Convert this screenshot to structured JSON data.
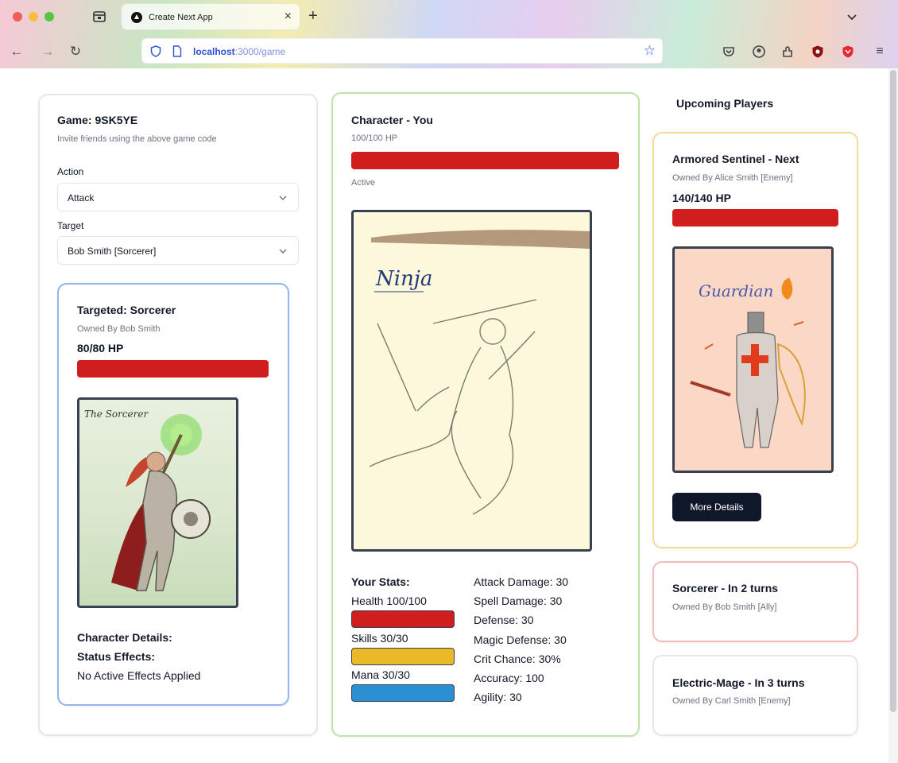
{
  "browser": {
    "tab_title": "Create Next App",
    "url_host": "localhost",
    "url_path": ":3000/game"
  },
  "game_panel": {
    "title": "Game: 9SK5YE",
    "subtitle": "Invite friends using the above game code",
    "action_label": "Action",
    "action_value": "Attack",
    "target_label": "Target",
    "target_value": "Bob Smith [Sorcerer]"
  },
  "targeted": {
    "title": "Targeted: Sorcerer",
    "owner": "Owned By Bob Smith",
    "hp_text": "80/80 HP",
    "hp_fraction": 1.0,
    "art_caption": "The Sorcerer",
    "details_label": "Character Details:",
    "status_label": "Status Effects:",
    "status_value": "No Active Effects Applied"
  },
  "character": {
    "title": "Character - You",
    "hp_text": "100/100 HP",
    "hp_fraction": 1.0,
    "status": "Active",
    "art_caption": "Ninja",
    "stats_title": "Your Stats:",
    "health": "Health 100/100",
    "skills": "Skills 30/30",
    "mana": "Mana 30/30",
    "attributes": [
      "Attack Damage: 30",
      "Spell Damage: 30",
      "Defense: 30",
      "Magic Defense: 30",
      "Crit Chance: 30%",
      "Accuracy: 100",
      "Agility: 30"
    ]
  },
  "upcoming": {
    "heading": "Upcoming Players",
    "next": {
      "title": "Armored Sentinel - Next",
      "owner": "Owned By Alice Smith [Enemy]",
      "hp_text": "140/140 HP",
      "hp_fraction": 1.0,
      "art_caption": "Guardian",
      "button": "More Details"
    },
    "players": [
      {
        "title": "Sorcerer - In 2 turns",
        "owner": "Owned By Bob Smith [Ally]"
      },
      {
        "title": "Electric-Mage - In 3 turns",
        "owner": "Owned By Carl Smith [Enemy]"
      }
    ]
  },
  "colors": {
    "hp": "#d01e1e",
    "skills": "#eab92a",
    "mana": "#2b8fd3",
    "button": "#0f172a",
    "border_blue": "#93b4f0",
    "border_green": "#bfe3a8",
    "border_yellow": "#f2dc95",
    "border_red": "#f3b9b9"
  },
  "icons": [
    "tab-list-icon",
    "nextjs-favicon",
    "close-icon",
    "plus-icon",
    "back-icon",
    "forward-icon",
    "reload-icon",
    "shield-icon",
    "page-icon",
    "bookmark-star-icon",
    "pocket-icon",
    "account-icon",
    "extensions-icon",
    "ublock-icon",
    "brave-icon",
    "menu-icon",
    "chevron-down-icon"
  ]
}
